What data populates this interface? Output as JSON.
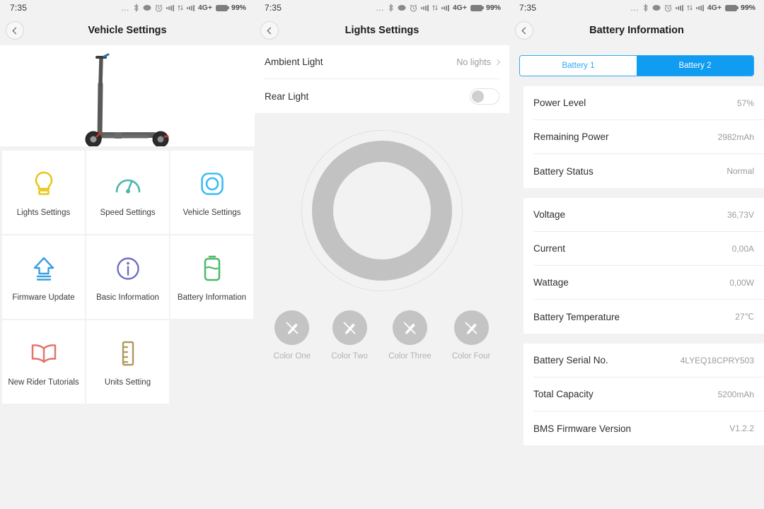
{
  "status_bar": {
    "time": "7:35",
    "dots": "...",
    "network_label": "4G+",
    "battery_percent": "99%",
    "icons": [
      "more-dots-icon",
      "bluetooth-icon",
      "do-not-disturb-icon",
      "alarm-clock-icon",
      "signal-bars-icon",
      "data-transfer-icon",
      "signal-bars-icon",
      "battery-icon"
    ]
  },
  "screens": [
    {
      "title": "Vehicle Settings",
      "hero_alt": "electric-scooter",
      "grid": [
        {
          "label": "Lights Settings",
          "icon": "bulb-icon",
          "color": "#e7c81f"
        },
        {
          "label": "Speed Settings",
          "icon": "speedometer-icon",
          "color": "#4cb6ad"
        },
        {
          "label": "Vehicle Settings",
          "icon": "lifebuoy-icon",
          "color": "#3bbdf0"
        },
        {
          "label": "Firmware Update",
          "icon": "upload-arrow-icon",
          "color": "#3a9ee0"
        },
        {
          "label": "Basic Information",
          "icon": "info-circle-icon",
          "color": "#6f6fc4"
        },
        {
          "label": "Battery Information",
          "icon": "battery-icon",
          "color": "#4cb96a"
        },
        {
          "label": "New Rider Tutorials",
          "icon": "book-icon",
          "color": "#e4746b"
        },
        {
          "label": "Units Setting",
          "icon": "ruler-icon",
          "color": "#b09a5b"
        }
      ]
    },
    {
      "title": "Lights Settings",
      "rows": [
        {
          "label": "Ambient Light",
          "value": "No lights",
          "control": "chevron"
        },
        {
          "label": "Rear Light",
          "value": "",
          "control": "toggle-off"
        }
      ],
      "colors": [
        {
          "label": "Color One",
          "icon": "brush-disabled-icon"
        },
        {
          "label": "Color Two",
          "icon": "brush-disabled-icon"
        },
        {
          "label": "Color Three",
          "icon": "brush-disabled-icon"
        },
        {
          "label": "Color Four",
          "icon": "brush-disabled-icon"
        }
      ]
    },
    {
      "title": "Battery Information",
      "tabs": [
        {
          "label": "Battery 1",
          "selected": false
        },
        {
          "label": "Battery 2",
          "selected": true
        }
      ],
      "accent_color": "#109cf1",
      "group_a": [
        {
          "label": "Power Level",
          "value": "57%"
        },
        {
          "label": "Remaining Power",
          "value": "2982mAh"
        },
        {
          "label": "Battery Status",
          "value": "Normal"
        }
      ],
      "group_b": [
        {
          "label": "Voltage",
          "value": "36,73V"
        },
        {
          "label": "Current",
          "value": "0,00A"
        },
        {
          "label": "Wattage",
          "value": "0,00W"
        },
        {
          "label": "Battery Temperature",
          "value": "27℃"
        }
      ],
      "group_c": [
        {
          "label": "Battery Serial No.",
          "value": "4LYEQ18CPRY503"
        },
        {
          "label": "Total Capacity",
          "value": "5200mAh"
        },
        {
          "label": "BMS Firmware Version",
          "value": "V1.2.2"
        }
      ]
    }
  ]
}
